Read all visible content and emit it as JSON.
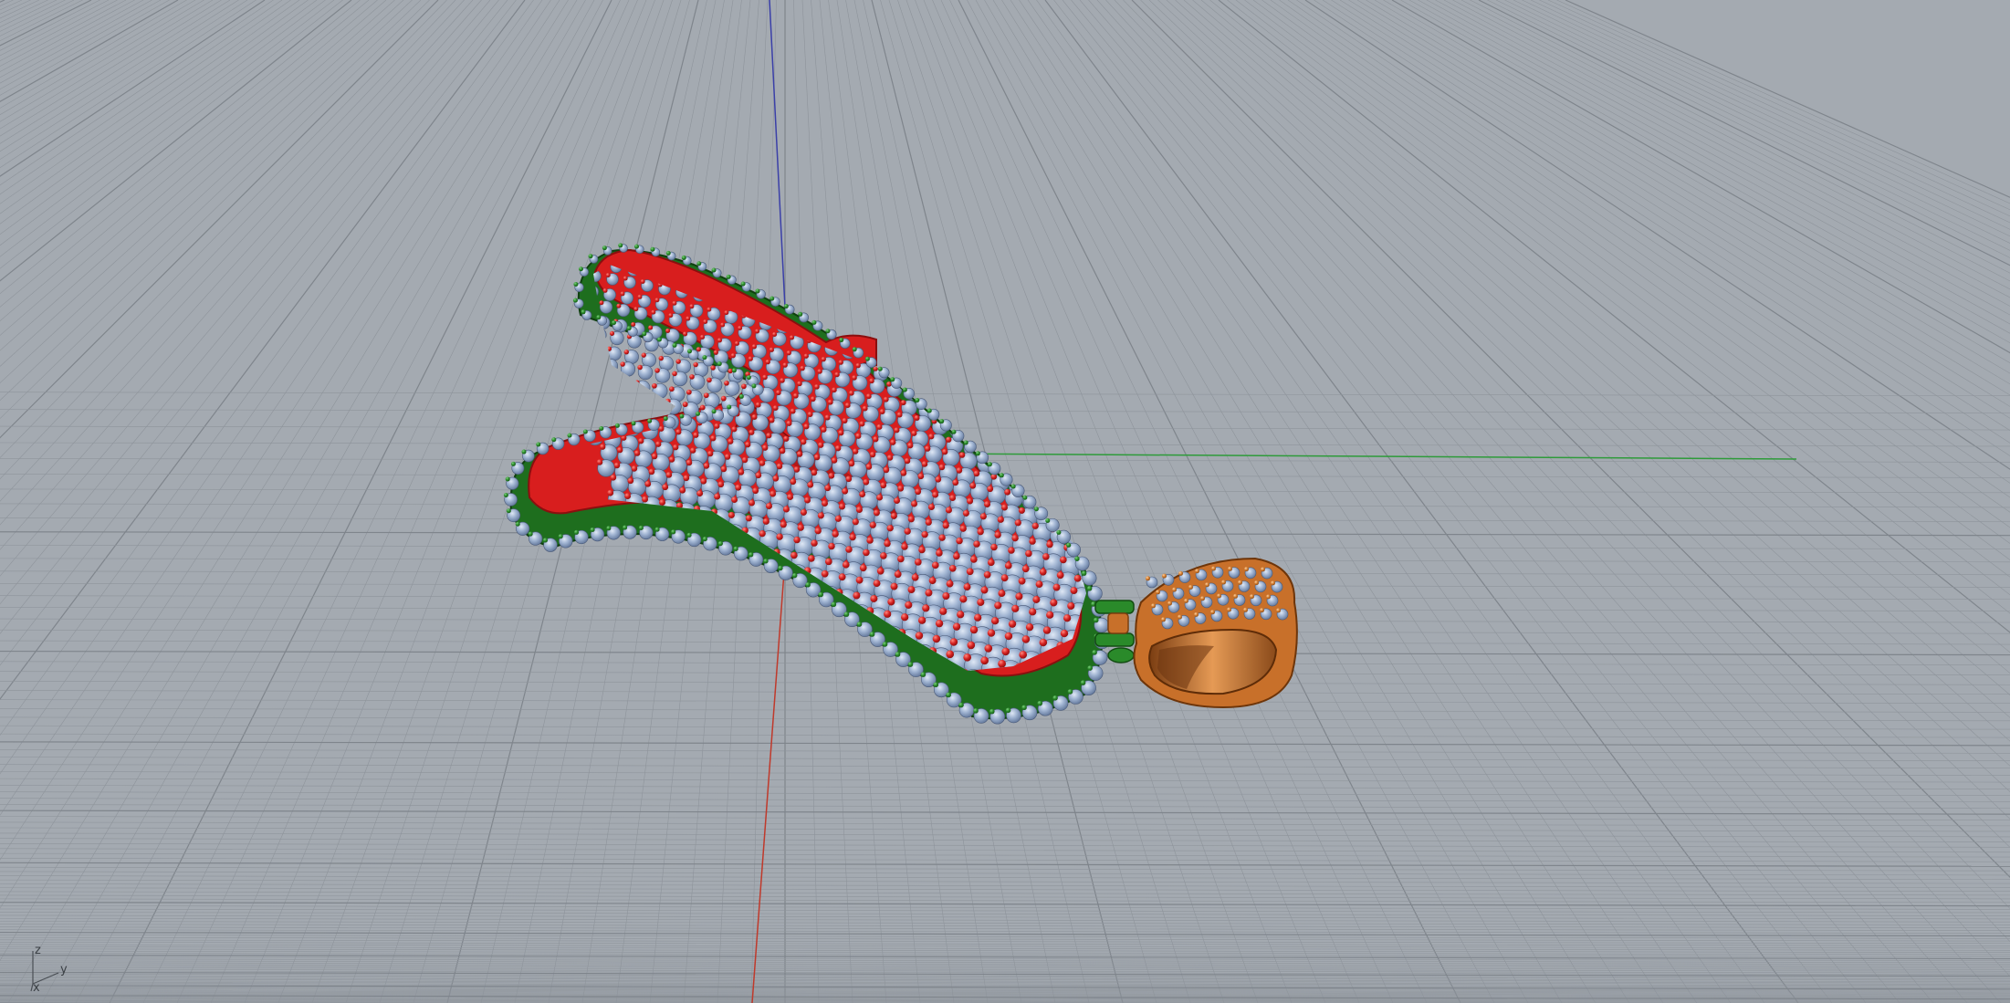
{
  "viewport": {
    "view_type": "Perspective",
    "display_mode": "Rendered",
    "background_color": "#a4aab1",
    "grid_color": "#8e949b",
    "grid_major_color": "#7f858c"
  },
  "world_axes": {
    "x_axis_color": "#c0392b",
    "y_axis_color": "#2e9b3a",
    "z_axis_color": "#3a3fa8"
  },
  "axis_widget": {
    "z_label": "z",
    "y_label": "y",
    "x_label": "x"
  },
  "model": {
    "description_icon": "pendant-model",
    "letter_metal_color": "#d81e1e",
    "outer_rim_color": "#1f7a1f",
    "bail_color": "#c8702a",
    "stone_color": "#8fa6c7",
    "prong_color": "#c41818"
  }
}
